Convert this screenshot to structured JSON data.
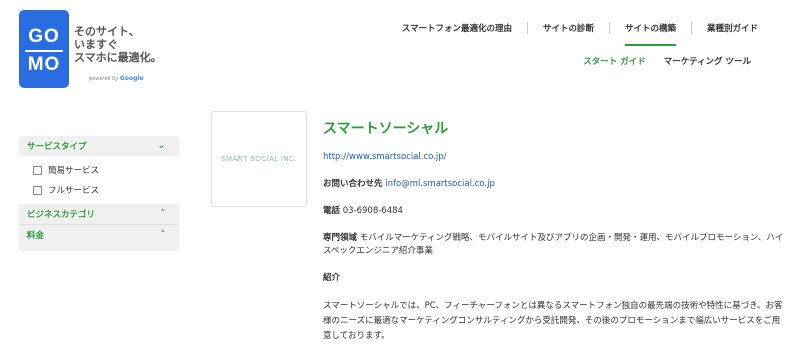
{
  "logo": {
    "row1": "GO",
    "row2": "MO",
    "tagline": "そのサイト、\nいますぐ\nスマホに最適化。",
    "powered": "powered by",
    "powered_brand": "Google"
  },
  "nav": {
    "items": [
      {
        "label": "スマートフォン最適化の理由"
      },
      {
        "label": "サイトの診断"
      },
      {
        "label": "サイトの構築"
      },
      {
        "label": "業種別ガイド"
      }
    ],
    "active_index": 2
  },
  "subnav": {
    "items": [
      {
        "label": "スタート ガイド"
      },
      {
        "label": "マーケティング ツール"
      }
    ]
  },
  "sidebar": {
    "service_type": {
      "label": "サービスタイプ",
      "options": [
        "簡易サービス",
        "フルサービス"
      ]
    },
    "business_category": {
      "label": "ビジネスカテゴリ"
    },
    "fee": {
      "label": "料金"
    }
  },
  "company": {
    "thumb_text": "SMART SOCIAL INC.",
    "name": "スマートソーシャル",
    "url": "http://www.smartsocial.co.jp/",
    "contact_label": "お問い合わせ先",
    "contact_email": "info@ml.smartsocial.co.jp",
    "phone_label": "電話",
    "phone": "03-6908-6484",
    "field_label": "専門領域",
    "field": "モバイルマーケティング戦略、モバイルサイト及びアプリの企画・開発・運用、モバイルプロモーション、ハイスペックエンジニア紹介事業",
    "intro_label": "紹介",
    "intro": "スマートソーシャルでは、PC、フィーチャーフォンとは異なるスマートフォン独自の最先端の技術や特性に基づき、お客様のニーズに最適なマーケティングコンサルティングから受託開発、その後のプロモーションまで幅広いサービスをご用意しております。"
  },
  "colors": {
    "green": "#2c9b3a",
    "blue": "#2a6de0",
    "link": "#1a5fb4"
  }
}
